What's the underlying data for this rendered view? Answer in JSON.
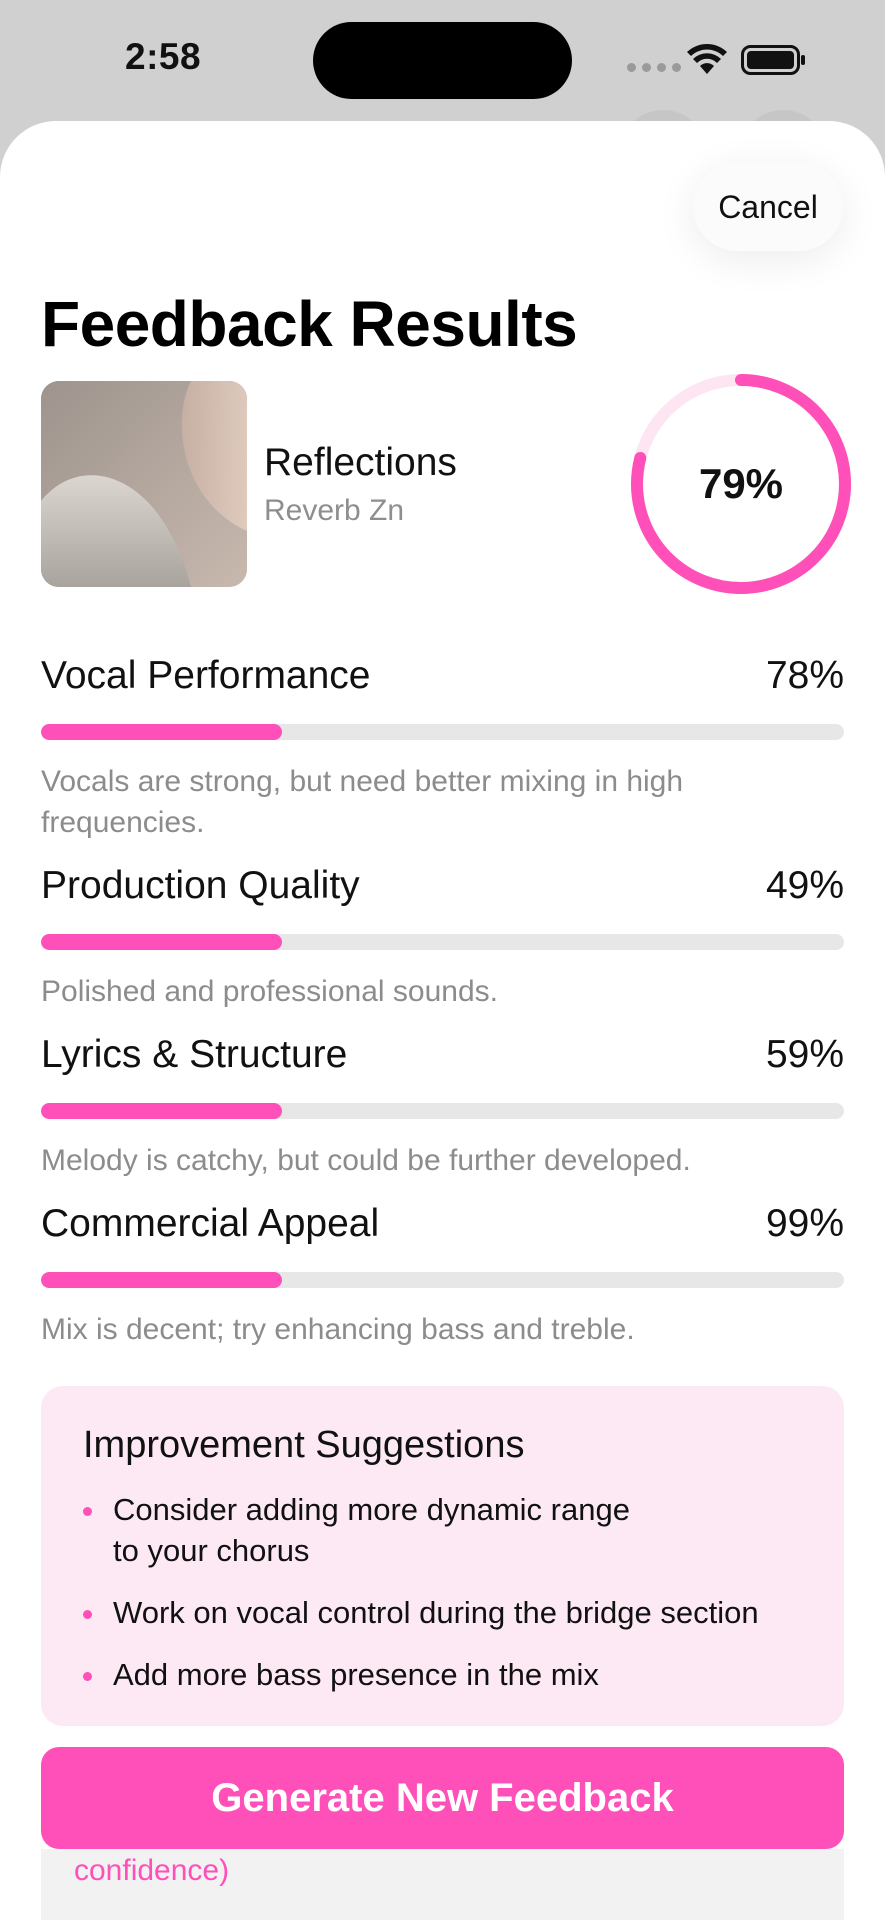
{
  "status_bar": {
    "time": "2:58"
  },
  "header": {
    "cancel_label": "Cancel",
    "title": "Feedback Results"
  },
  "track": {
    "title": "Reflections",
    "artist": "Reverb Zn"
  },
  "overall_score": {
    "value_text": "79%",
    "value": 0.79
  },
  "metrics": [
    {
      "label": "Vocal Performance",
      "value": "78%",
      "bar_fill": 0.3,
      "description": "Vocals are strong, but need better mixing in high frequencies."
    },
    {
      "label": "Production Quality",
      "value": "49%",
      "bar_fill": 0.3,
      "description": "Polished and professional sounds."
    },
    {
      "label": "Lyrics & Structure",
      "value": "59%",
      "bar_fill": 0.3,
      "description": "Melody is catchy, but could be further developed."
    },
    {
      "label": "Commercial Appeal",
      "value": "99%",
      "bar_fill": 0.3,
      "description": "Mix is decent; try enhancing bass and treble."
    }
  ],
  "suggestions": {
    "title": "Improvement Suggestions",
    "items": [
      "Consider adding more dynamic range to your chorus",
      "Work on vocal control during the bridge section",
      "Add more bass presence in the mix"
    ]
  },
  "generate_button_label": "Generate New Feedback",
  "bottom_partial_text": "confidence)",
  "colors": {
    "accent": "#ff4fb8",
    "suggestion_bg": "#fde9f4",
    "track_bg": "#e7e7e7"
  }
}
